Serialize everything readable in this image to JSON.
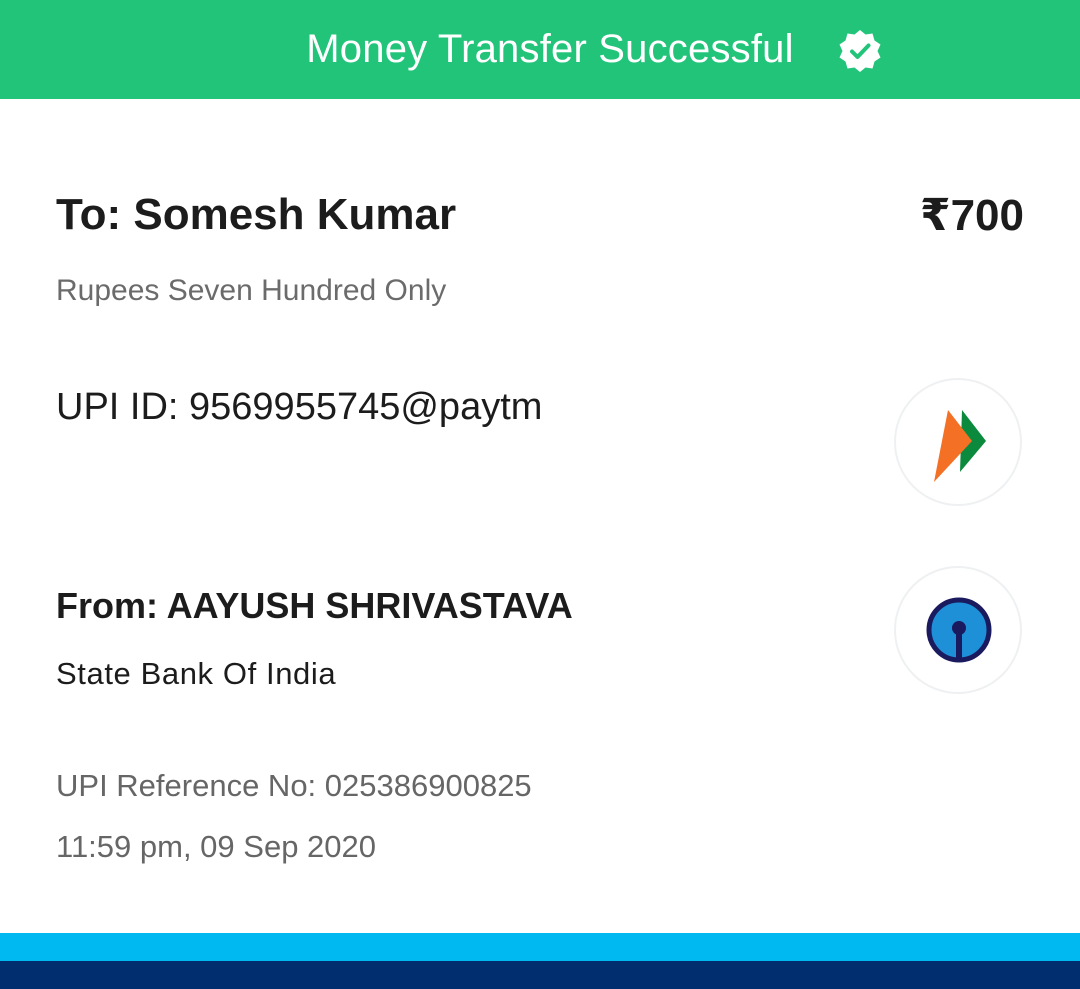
{
  "header": {
    "title": "Money Transfer Successful",
    "badge_icon": "verified-check-badge",
    "background_color": "#22c47a"
  },
  "recipient": {
    "to_label": "To: Somesh Kumar",
    "amount": "₹700",
    "amount_words": "Rupees Seven Hundred Only",
    "upi_id": "UPI ID: 9569955745@paytm",
    "logo_icon": "upi-logo"
  },
  "sender": {
    "from_label": "From: AAYUSH SHRIVASTAVA",
    "bank": "State Bank Of India",
    "logo_icon": "sbi-logo"
  },
  "transaction": {
    "reference": "UPI Reference No: 025386900825",
    "datetime": "11:59 pm, 09 Sep 2020"
  },
  "footer": {
    "band_light_color": "#00b9f1",
    "band_dark_color": "#002e6e"
  }
}
